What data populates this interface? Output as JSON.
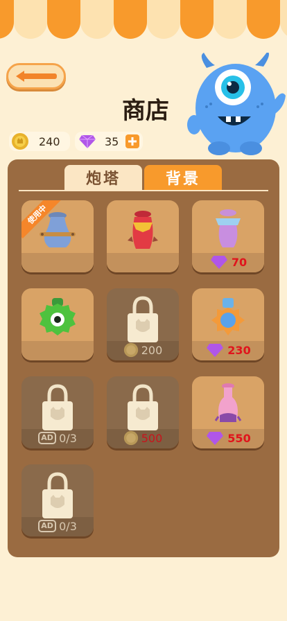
{
  "header": {
    "title": "商店"
  },
  "resources": {
    "coins": "240",
    "gems": "35"
  },
  "tabs": {
    "turret": "炮塔",
    "background": "背景"
  },
  "colors": {
    "accent": "#f89a2c",
    "panel": "#9a6b41",
    "price_red": "#e0141c"
  },
  "items": [
    {
      "state": "in_use",
      "badge": "使用中"
    },
    {
      "state": "owned"
    },
    {
      "state": "buy",
      "currency": "gem",
      "price": "70"
    },
    {
      "state": "owned"
    },
    {
      "state": "locked",
      "currency": "coin",
      "price": "200"
    },
    {
      "state": "buy",
      "currency": "gem",
      "price": "230"
    },
    {
      "state": "locked",
      "currency": "ad",
      "progress": "0/3"
    },
    {
      "state": "locked",
      "currency": "coin",
      "price": "500"
    },
    {
      "state": "buy",
      "currency": "gem",
      "price": "550"
    },
    {
      "state": "locked",
      "currency": "ad",
      "progress": "0/3"
    }
  ],
  "ad_label": "AD"
}
